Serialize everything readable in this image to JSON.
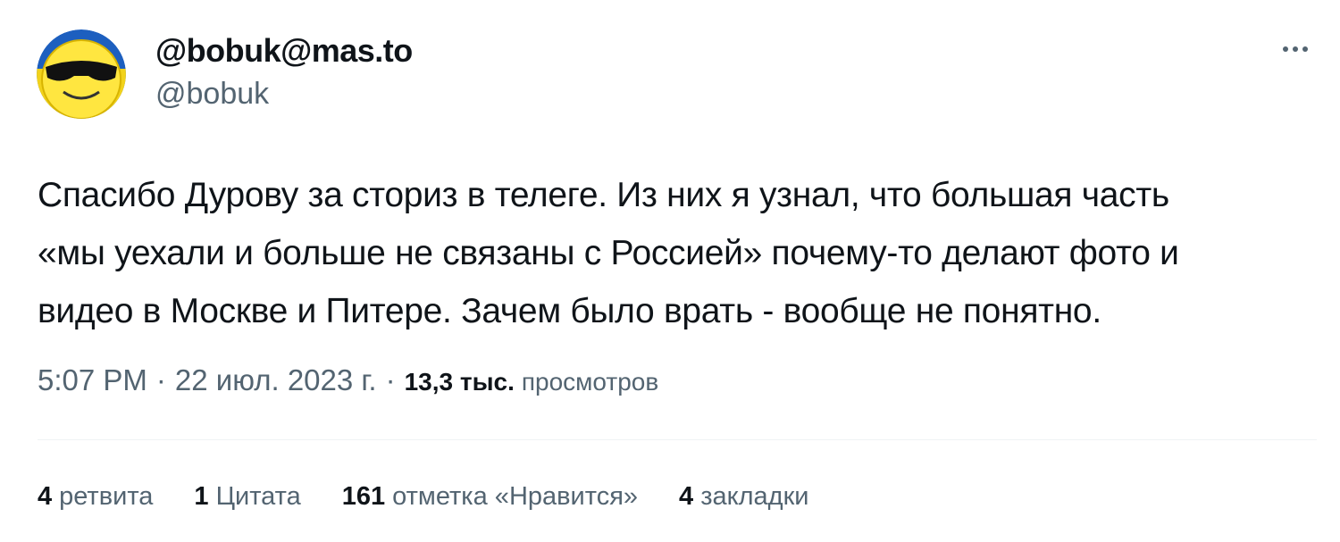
{
  "author": {
    "display_name": "@bobuk@mas.to",
    "handle": "@bobuk",
    "avatar_icon": "sunglasses-smiley-avatar"
  },
  "more_icon": "more-horizontal-icon",
  "tweet": {
    "text": "Спасибо Дурову за сториз в телеге. Из них я узнал, что большая часть\n«мы уехали и больше не связаны с Россией» почему-то делают фото и\nвидео в Москве и Питере. Зачем было врать - вообще не понятно."
  },
  "meta": {
    "time": "5:07 PM",
    "separator": "·",
    "date": "22 июл. 2023 г.",
    "views_count": "13,3 тыс.",
    "views_label": "просмотров"
  },
  "stats": [
    {
      "count": "4",
      "label": "ретвита"
    },
    {
      "count": "1",
      "label": "Цитата"
    },
    {
      "count": "161",
      "label": "отметка «Нравится»"
    },
    {
      "count": "4",
      "label": "закладки"
    }
  ],
  "colors": {
    "text": "#0f1419",
    "secondary": "#536471",
    "divider": "#eff3f4"
  }
}
